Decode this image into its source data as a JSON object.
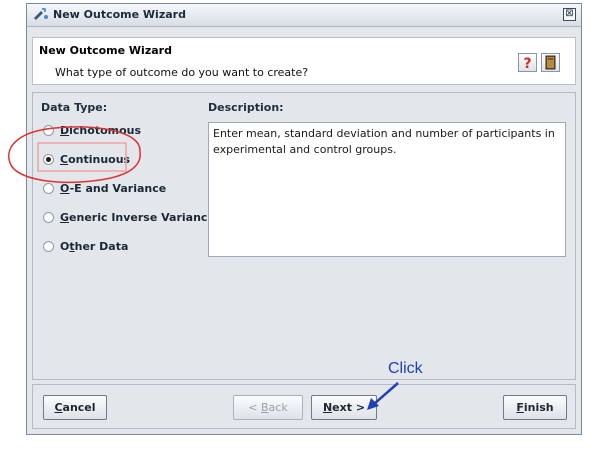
{
  "window": {
    "title": "New Outcome Wizard",
    "close_glyph": "⊠"
  },
  "header": {
    "title": "New Outcome Wizard",
    "subtitle": "What type of outcome do you want to create?",
    "help_icon": "help-icon",
    "book_icon": "book-icon"
  },
  "data_type": {
    "label": "Data Type:",
    "options": [
      {
        "mnemonic": "D",
        "rest": "ichotomous",
        "selected": false
      },
      {
        "mnemonic": "C",
        "rest": "ontinuous",
        "selected": true
      },
      {
        "mnemonic": "O",
        "rest": "-E and Variance",
        "selected": false
      },
      {
        "mnemonic": "G",
        "rest": "eneric Inverse Variance",
        "selected": false
      },
      {
        "pre": "O",
        "mnemonic": "t",
        "rest": "her Data",
        "selected": false
      }
    ]
  },
  "description": {
    "label": "Description:",
    "text": "Enter mean, standard deviation and number of participants in experimental and control groups."
  },
  "buttons": {
    "cancel": {
      "mnemonic": "C",
      "rest": "ancel"
    },
    "back": {
      "pre": "< ",
      "mnemonic": "B",
      "rest": "ack",
      "enabled": false
    },
    "next": {
      "mnemonic": "N",
      "rest": "ext >"
    },
    "finish": {
      "mnemonic": "F",
      "rest": "inish"
    }
  },
  "annotation": {
    "text": "Click",
    "color": "#1f3fb4",
    "circle_color": "#e03030"
  }
}
